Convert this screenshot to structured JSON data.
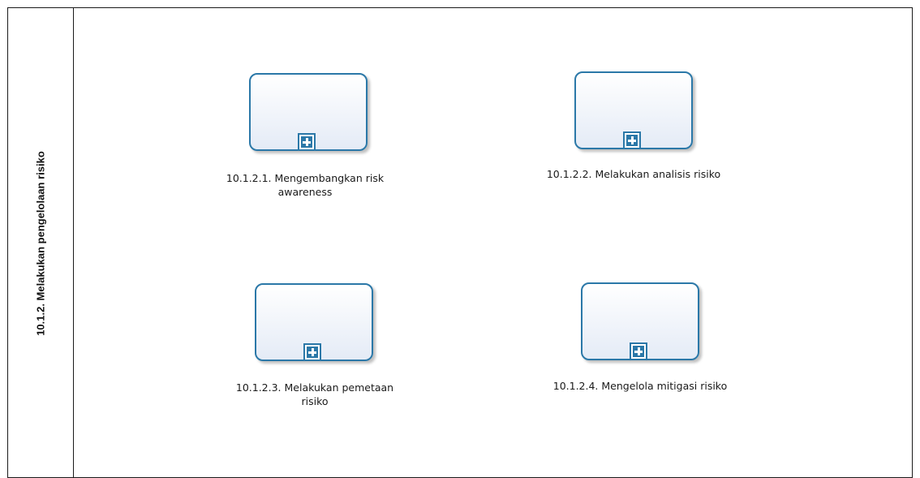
{
  "lane": {
    "title": "10.1.2. Melakukan pengelolaan risiko"
  },
  "tasks": [
    {
      "label_line1": "10.1.2.1. Mengembangkan risk",
      "label_line2": "awareness",
      "marker": "plus-icon"
    },
    {
      "label_line1": "10.1.2.2. Melakukan analisis risiko",
      "label_line2": "",
      "marker": "plus-icon"
    },
    {
      "label_line1": "10.1.2.3. Melakukan pemetaan",
      "label_line2": "risiko",
      "marker": "plus-icon"
    },
    {
      "label_line1": "10.1.2.4. Mengelola mitigasi risiko",
      "label_line2": "",
      "marker": "plus-icon"
    }
  ],
  "colors": {
    "task_border": "#2b78a8",
    "task_fill_top": "#ffffff",
    "task_fill_bottom": "#e4ebf6",
    "lines": "#1a1a1a"
  }
}
